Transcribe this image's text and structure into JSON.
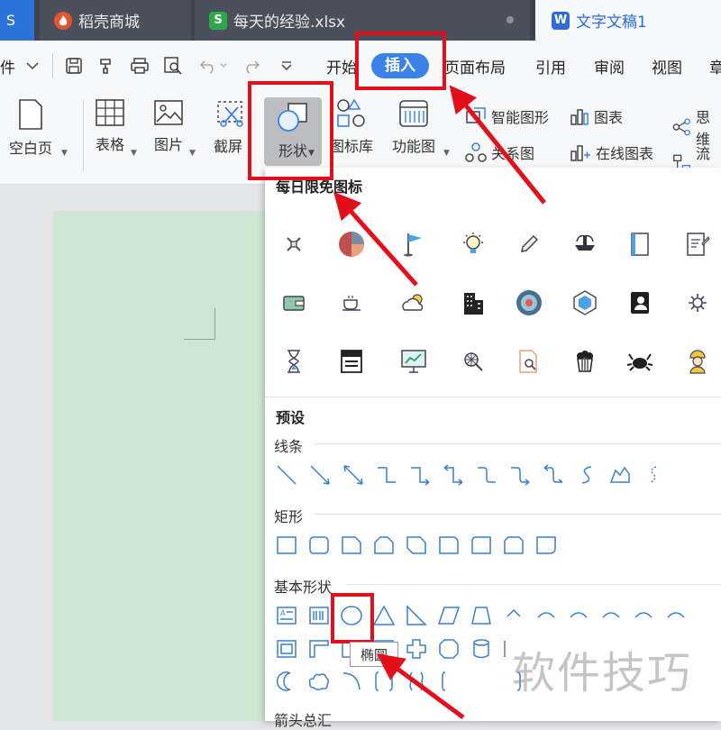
{
  "tabs": [
    {
      "label": "S",
      "icon": "wps-logo-icon"
    },
    {
      "label": "稻壳商城",
      "icon": "docer-flame-icon"
    },
    {
      "label": "每天的经验.xlsx",
      "icon": "spreadsheet-s-icon"
    },
    {
      "label": "文字文稿1",
      "icon": "writer-w-icon"
    }
  ],
  "menu": {
    "file": "件",
    "start": "开始",
    "insert": "插入",
    "page_layout": "页面布局",
    "reference": "引用",
    "review": "审阅",
    "view": "视图",
    "chapter": "章"
  },
  "ribbon": {
    "blank_page": "空白页",
    "table": "表格",
    "picture": "图片",
    "screenshot": "截屏",
    "shape": "形状",
    "icon_lib": "图标库",
    "func_chart": "功能图",
    "smart_graphic": "智能图形",
    "chart": "图表",
    "mind": "思维",
    "relation": "关系图",
    "online_chart": "在线图表",
    "flow": "流程"
  },
  "panel": {
    "daily_title": "每日限免图标",
    "preset_title": "预设",
    "sections": {
      "lines": "线条",
      "rect": "矩形",
      "basic": "基本形状",
      "arrows": "箭头总汇"
    },
    "tooltip": "椭圆"
  },
  "watermark": "软件技巧",
  "colors": {
    "accent": "#3b82e8",
    "highlight": "#e3101b",
    "tab_bg": "#3d4450",
    "page": "#cfe7d2"
  }
}
